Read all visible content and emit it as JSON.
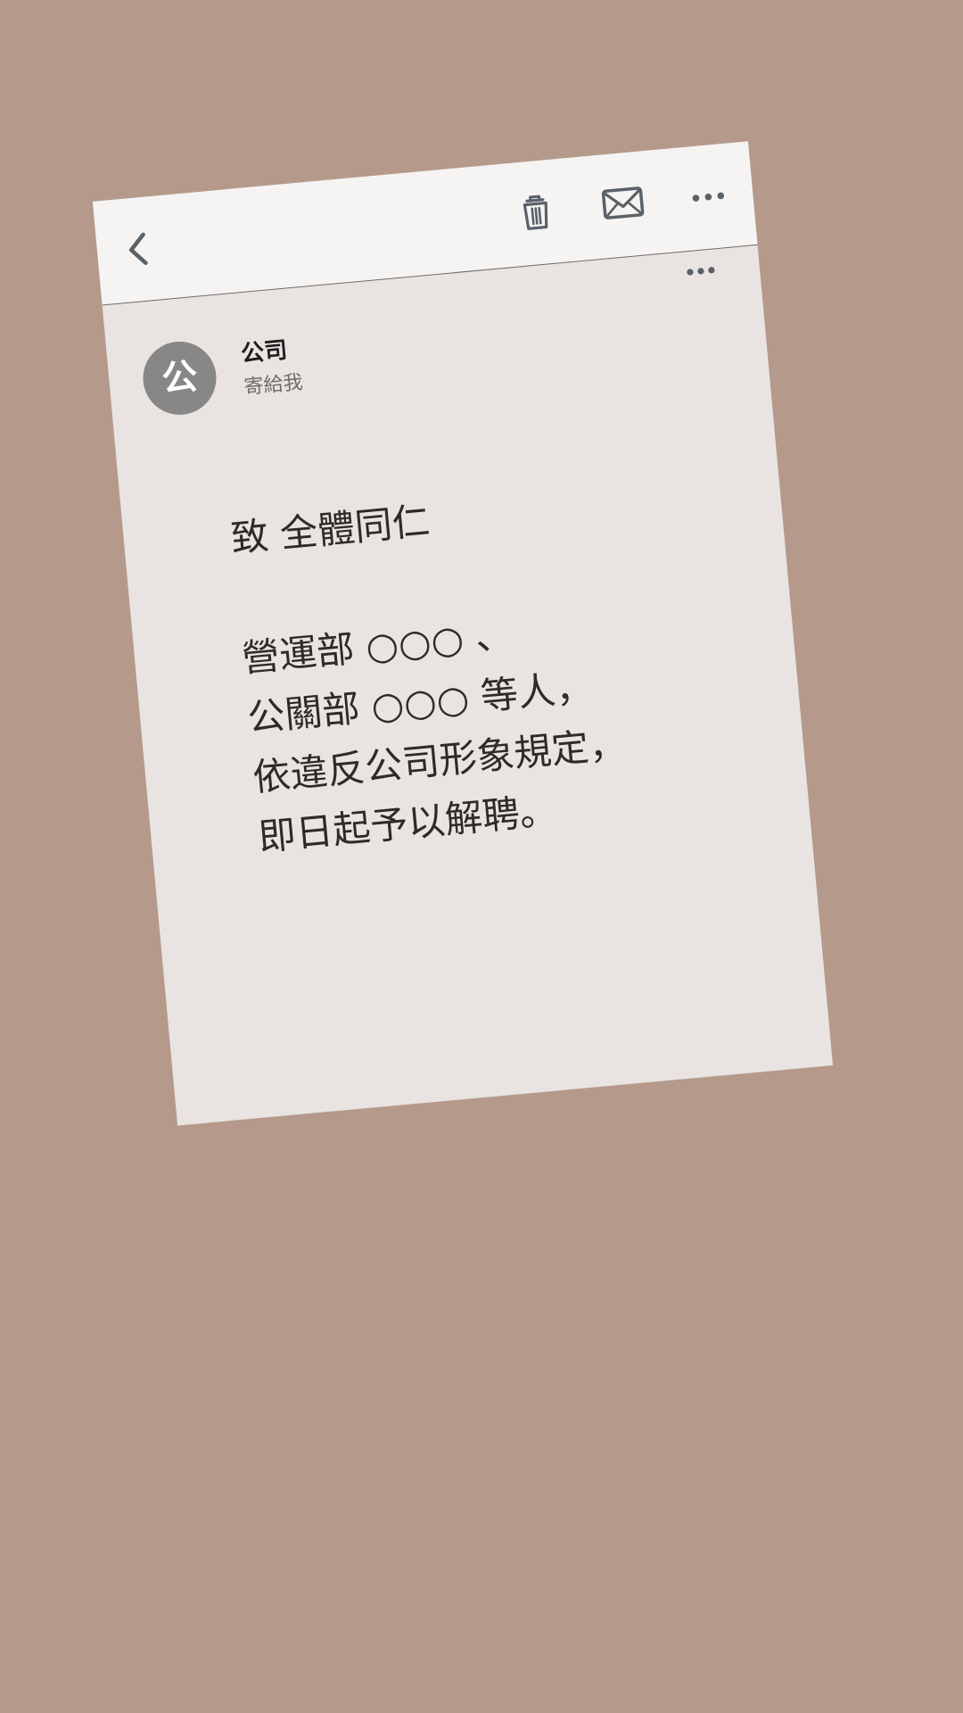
{
  "toolbar": {
    "back_icon": "back-chevron-icon",
    "trash_icon": "trash-icon",
    "mail_icon": "mail-icon",
    "more_icon": "more-horizontal-icon"
  },
  "message_header": {
    "more_icon": "more-horizontal-icon",
    "avatar_initial": "公",
    "sender_name": "公司",
    "recipient": "寄給我"
  },
  "message": {
    "greeting": "致 全體同仁",
    "lines": [
      "營運部 ○○○ 、",
      "公關部 ○○○ 等人，",
      "依違反公司形象規定，",
      "即日起予以解聘。"
    ]
  },
  "colors": {
    "background": "#b59a8c",
    "toolbar": "#f5f4f3",
    "card": "#e9e4e1",
    "avatar": "#878786",
    "icon": "#5a6168",
    "text": "#2e2a28"
  }
}
